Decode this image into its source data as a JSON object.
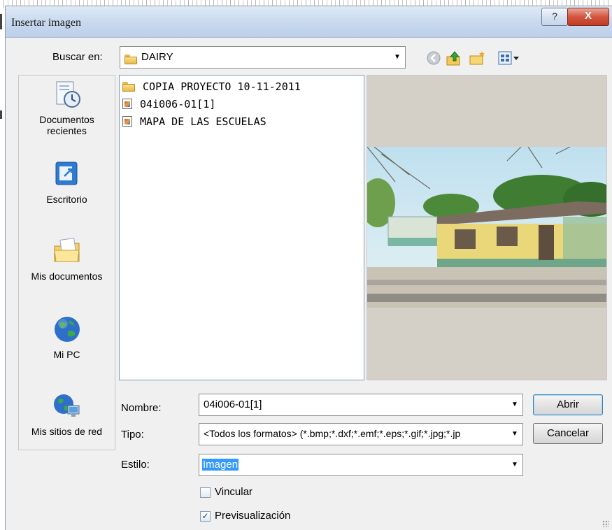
{
  "window": {
    "title": "Insertar imagen",
    "help_label": "?",
    "close_label": "X"
  },
  "lookin": {
    "label": "Buscar en:",
    "value": "DAIRY"
  },
  "toolbar": {
    "icons": [
      "back-icon",
      "up-folder-icon",
      "new-folder-icon",
      "view-menu-icon"
    ]
  },
  "places": [
    {
      "label": "Documentos recientes",
      "icon": "recent-documents-icon"
    },
    {
      "label": "Escritorio",
      "icon": "desktop-icon"
    },
    {
      "label": "Mis documentos",
      "icon": "my-documents-icon"
    },
    {
      "label": "Mi PC",
      "icon": "my-computer-icon"
    },
    {
      "label": "Mis sitios de red",
      "icon": "network-places-icon"
    }
  ],
  "files": [
    {
      "name": "COPIA PROYECTO 10-11-2011",
      "icon": "folder-icon"
    },
    {
      "name": "04i006-01[1]",
      "icon": "image-file-icon"
    },
    {
      "name": "MAPA DE LAS ESCUELAS",
      "icon": "image-file-icon"
    }
  ],
  "form": {
    "name_label": "Nombre:",
    "name_value": "04i006-01[1]",
    "type_label": "Tipo:",
    "type_value": "<Todos los formatos> (*.bmp;*.dxf;*.emf;*.eps;*.gif;*.jpg;*.jp",
    "style_label": "Estilo:",
    "style_value": "Imagen"
  },
  "buttons": {
    "open": "Abrir",
    "cancel": "Cancelar"
  },
  "options": {
    "link_label": "Vincular",
    "link_checked": false,
    "preview_label": "Previsualización",
    "preview_checked": true
  }
}
